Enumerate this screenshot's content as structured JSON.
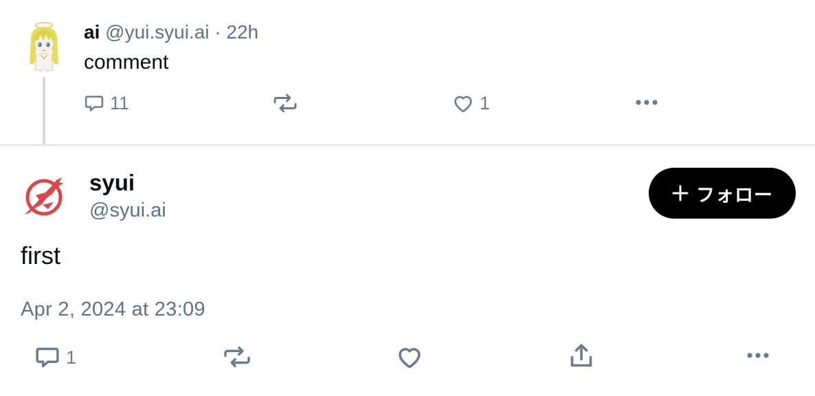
{
  "parent_post": {
    "author_name": "ai",
    "author_handle": "@yui.syui.ai",
    "separator": "·",
    "time_ago": "22h",
    "text": "comment",
    "avatar_icon": "anime-character-avatar",
    "actions": {
      "reply_icon": "comment-bubble-icon",
      "reply_count": "11",
      "repost_icon": "repost-icon",
      "like_icon": "heart-icon",
      "like_count": "1",
      "more_icon": "ellipsis-icon"
    }
  },
  "main_post": {
    "author_name": "syui",
    "author_handle": "@syui.ai",
    "avatar_icon": "red-bird-logo-avatar",
    "follow_button": {
      "icon": "plus-icon",
      "label": "フォロー"
    },
    "text": "first",
    "datetime": "Apr 2, 2024 at 23:09",
    "actions": {
      "reply_icon": "comment-bubble-icon",
      "reply_count": "1",
      "repost_icon": "repost-icon",
      "like_icon": "heart-icon",
      "share_icon": "share-upload-icon",
      "more_icon": "ellipsis-icon"
    }
  },
  "colors": {
    "icon_gray": "#6b7b8f",
    "secondary_text": "#5f7186",
    "follow_button_bg": "#000000",
    "avatar_red": "#d9474b",
    "thread_line": "#d4d9e0"
  }
}
